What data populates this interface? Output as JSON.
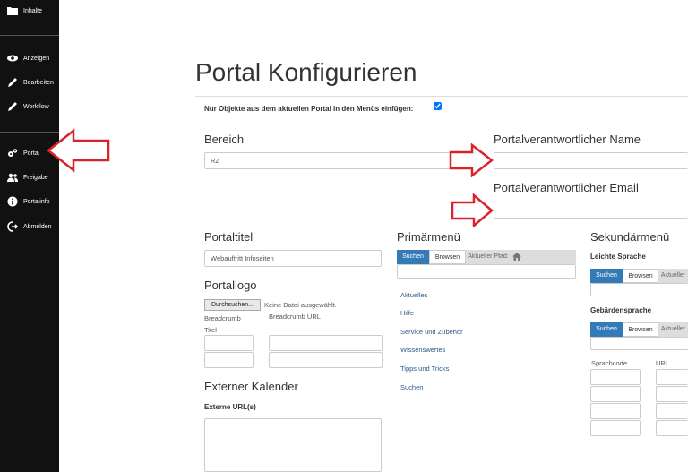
{
  "sidebar": {
    "items": [
      {
        "label": "Inhalte",
        "icon": "folder-icon"
      },
      {
        "label": "Anzeigen",
        "icon": "eye-icon"
      },
      {
        "label": "Bearbeiten",
        "icon": "pencil-icon"
      },
      {
        "label": "Workflow",
        "icon": "pencil-icon"
      },
      {
        "label": "Portal",
        "icon": "gears-icon"
      },
      {
        "label": "Freigabe",
        "icon": "users-icon"
      },
      {
        "label": "Portalinfo",
        "icon": "info-icon"
      },
      {
        "label": "Abmelden",
        "icon": "logout-icon"
      }
    ]
  },
  "page": {
    "title": "Portal Konfigurieren",
    "only_portal_label": "Nur Objekte aus dem aktuellen Portal in den Menüs einfügen:",
    "only_portal_checked": true
  },
  "bereich": {
    "label": "Bereich",
    "value": "RZ"
  },
  "responsible": {
    "name_label": "Portalverantwortlicher Name",
    "name_value": "",
    "email_label": "Portalverantwortlicher Email",
    "email_value": ""
  },
  "portaltitel": {
    "label": "Portaltitel",
    "value": "Webauftritt Infoseiten"
  },
  "portallogo": {
    "label": "Portallogo",
    "browse_button": "Durchsuchen...",
    "no_file": "Keine Datei ausgewählt."
  },
  "breadcrumb": {
    "title_label": "Breadcrumb Titel",
    "url_label": "Breadcrumb URL"
  },
  "kalender": {
    "label": "Externer Kalender",
    "urls_label": "Externe URL(s)"
  },
  "primaermenu": {
    "label": "Primärmenü",
    "tab_suchen": "Suchen",
    "tab_browsen": "Browsen",
    "current_path": "Aktueller Pfad:",
    "items": [
      "Aktuelles",
      "Hilfe",
      "Service und Zubehör",
      "Wissenswertes",
      "Tipps und Tricks",
      "Suchen"
    ]
  },
  "sekundaermenu": {
    "label": "Sekundärmenü",
    "leichte_sprache": "Leichte Sprache",
    "gebaerdensprache": "Gebärdensprache",
    "tab_suchen": "Suchen",
    "tab_browsen": "Browsen",
    "current_path": "Aktueller",
    "col_sprachcode": "Sprachcode",
    "col_url": "URL"
  },
  "colors": {
    "sidebar_bg": "#111111",
    "accent": "#337ab7",
    "annotation_arrow": "#d9232a"
  }
}
